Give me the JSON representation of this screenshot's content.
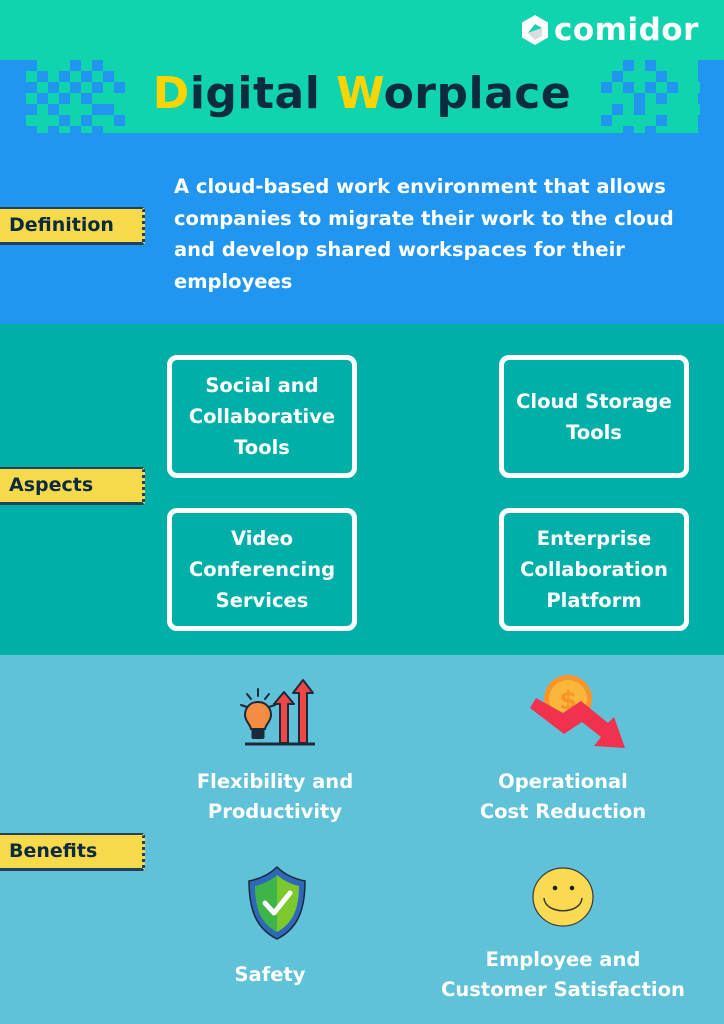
{
  "brand": {
    "logo_text": "comidor",
    "logo_icon": "comidor-logo-icon"
  },
  "header": {
    "title_parts": [
      {
        "text": "D",
        "highlight": true
      },
      {
        "text": "igital ",
        "highlight": false
      },
      {
        "text": "W",
        "highlight": true
      },
      {
        "text": "orplace",
        "highlight": false
      }
    ]
  },
  "colors": {
    "teal_top": "#0fd4ad",
    "blue": "#2196f0",
    "teal_dark": "#00b0a8",
    "light_blue": "#5fc2d8",
    "tag_yellow": "#f7d94c",
    "title_highlight": "#fdd400",
    "title_dark": "#0d2b3e"
  },
  "sections": {
    "definition": {
      "tag": "Definition",
      "text": "A cloud-based work environment that allows companies to migrate their work to the cloud and develop shared workspaces for their employees"
    },
    "aspects": {
      "tag": "Aspects",
      "items": [
        {
          "label": "Social and Collaborative Tools"
        },
        {
          "label": "Cloud Storage Tools"
        },
        {
          "label": "Video Conferencing Services"
        },
        {
          "label": "Enterprise Collaboration Platform"
        }
      ]
    },
    "benefits": {
      "tag": "Benefits",
      "items": [
        {
          "label_lines": [
            "Flexibility and",
            "Productivity"
          ],
          "icon": "lightbulb-growth-icon"
        },
        {
          "label_lines": [
            "Operational",
            "Cost Reduction"
          ],
          "icon": "cost-reduction-icon"
        },
        {
          "label_lines": [
            "Safety"
          ],
          "icon": "shield-check-icon"
        },
        {
          "label_lines": [
            "Employee and",
            "Customer Satisfaction"
          ],
          "icon": "smiley-face-icon"
        }
      ]
    }
  }
}
